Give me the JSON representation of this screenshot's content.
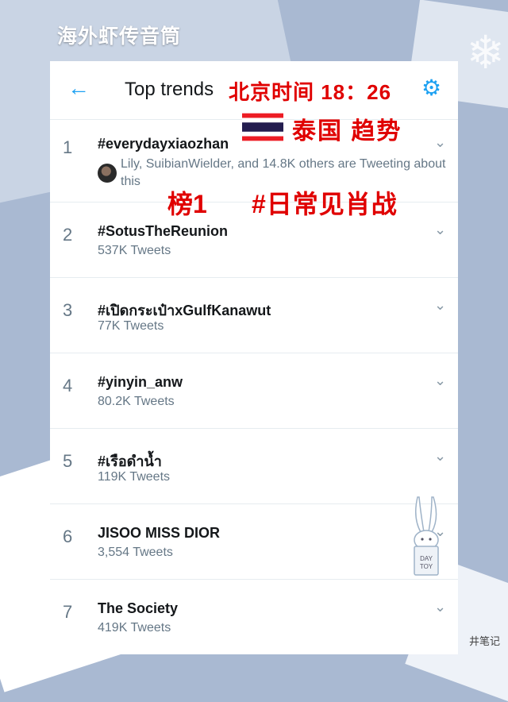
{
  "watermark": {
    "brand": "海外虾传音筒",
    "corner_note": "井笔记"
  },
  "header": {
    "title": "Top trends",
    "back_icon": "arrow-left-icon",
    "settings_icon": "gear-icon"
  },
  "overlay": {
    "beijing_time": "北京时间 18：26",
    "country_trend": "泰国 趋势",
    "rank_label": "榜1",
    "rank_tag": "#日常见肖战",
    "flag": "thailand-flag-icon",
    "color": "#e00000"
  },
  "trends": [
    {
      "rank": "1",
      "tag": "#everydayxiaozhan",
      "social": "Lily, SuibianWielder, and 14.8K others are Tweeting about this"
    },
    {
      "rank": "2",
      "tag": "#SotusTheReunion",
      "count": "537K Tweets"
    },
    {
      "rank": "3",
      "tag": "#เปิดกระเป๋าxGulfKanawut",
      "count": "77K Tweets"
    },
    {
      "rank": "4",
      "tag": "#yinyin_anw",
      "count": "80.2K Tweets"
    },
    {
      "rank": "5",
      "tag": "#เรือดำน้ำ",
      "count": "119K Tweets"
    },
    {
      "rank": "6",
      "tag": "JISOO MISS DIOR",
      "count": "3,554 Tweets"
    },
    {
      "rank": "7",
      "tag": "The Society",
      "count": "419K Tweets"
    }
  ],
  "sticker": {
    "label_line1": "DAY",
    "label_line2": "TOY"
  },
  "colors": {
    "accent": "#1da1f2",
    "text": "#14171a",
    "muted": "#657786"
  }
}
